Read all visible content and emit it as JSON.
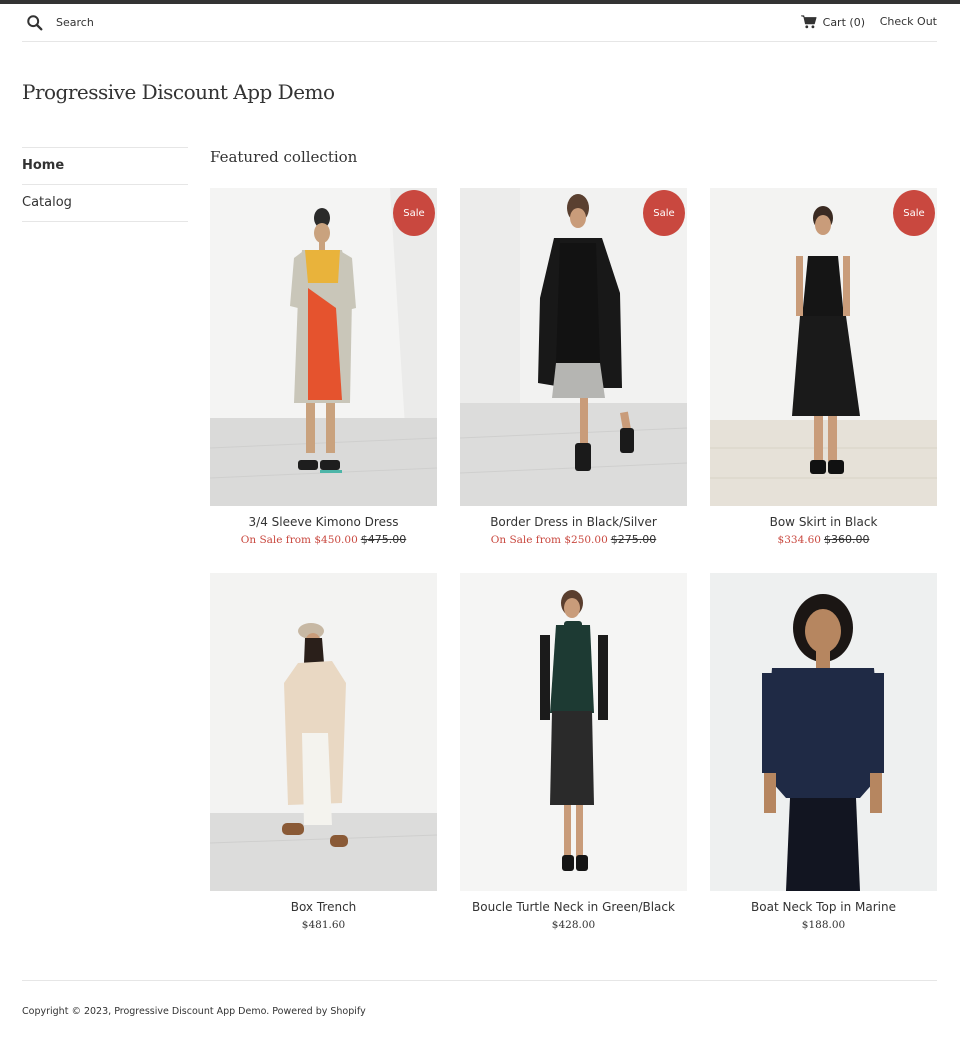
{
  "header": {
    "search_placeholder": "Search",
    "cart_label": "Cart",
    "cart_count": "(0)",
    "checkout_label": "Check Out"
  },
  "site_title": "Progressive Discount App Demo",
  "sidebar": {
    "items": [
      {
        "label": "Home",
        "active": true
      },
      {
        "label": "Catalog",
        "active": false
      }
    ]
  },
  "section_title": "Featured collection",
  "sale_badge": "Sale",
  "products": [
    {
      "title": "3/4 Sleeve Kimono Dress",
      "sale_price": "On Sale from $450.00",
      "compare_price": "$475.00",
      "on_sale": true
    },
    {
      "title": "Border Dress in Black/Silver",
      "sale_price": "On Sale from $250.00",
      "compare_price": "$275.00",
      "on_sale": true
    },
    {
      "title": "Bow Skirt in Black",
      "sale_price": "$334.60",
      "compare_price": "$360.00",
      "on_sale": true
    },
    {
      "title": "Box Trench",
      "price": "$481.60",
      "on_sale": false
    },
    {
      "title": "Boucle Turtle Neck in Green/Black",
      "price": "$428.00",
      "on_sale": false
    },
    {
      "title": "Boat Neck Top in Marine",
      "price": "$188.00",
      "on_sale": false
    }
  ],
  "footer": {
    "copyright": "Copyright © 2023,",
    "store_link": "Progressive Discount App Demo",
    "powered": "Powered by Shopify"
  },
  "colors": {
    "accent_sale": "#c9483f",
    "text": "#333333",
    "border": "#e6e6e6"
  }
}
